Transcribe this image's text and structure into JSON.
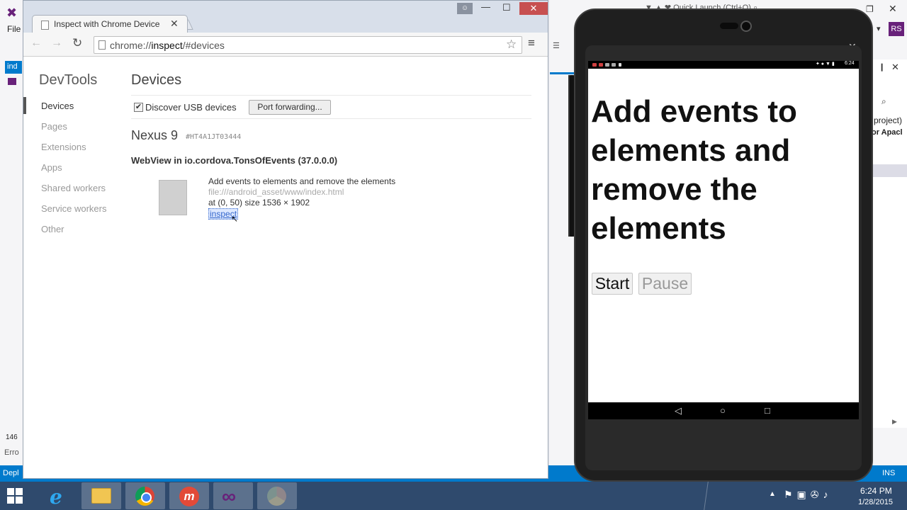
{
  "vs": {
    "file_menu": "File",
    "left_tab": "ind",
    "left_number": "146",
    "left_error": "Erro",
    "status_left": "Depl",
    "status_ins": "INS",
    "right_text_1": "project)",
    "right_text_2": "or Apacl",
    "user_initials": "RS",
    "top_fragment": "▼ ▲ ❤ Quick Launch (Ctrl+Q) ⌕"
  },
  "chrome": {
    "tab_title": "Inspect with Chrome Devices",
    "url_scheme": "chrome://",
    "url_host": "inspect",
    "url_path": "/#devices",
    "sidebar_title": "DevTools",
    "nav": [
      {
        "label": "Devices",
        "active": true
      },
      {
        "label": "Pages"
      },
      {
        "label": "Extensions"
      },
      {
        "label": "Apps"
      },
      {
        "label": "Shared workers"
      },
      {
        "label": "Service workers"
      },
      {
        "label": "Other"
      }
    ],
    "heading": "Devices",
    "discover_label": "Discover USB devices",
    "discover_checked": true,
    "port_forwarding_label": "Port forwarding...",
    "device_name": "Nexus 9",
    "device_serial": "#HT4A1JT03444",
    "webview_title": "WebView in io.cordova.TonsOfEvents (37.0.0.0)",
    "target_title": "Add events to elements and remove the elements",
    "target_url": "file:///android_asset/www/index.html",
    "target_meta": "at (0, 50)  size 1536 × 1902",
    "inspect_label": "inspect"
  },
  "emulator": {
    "status_time": "6:24",
    "status_icons": "✦ ● ▼ ▮",
    "app_heading": "Add events to elements and remove the elements",
    "start_label": "Start",
    "pause_label": "Pause",
    "nav_back": "◁",
    "nav_home": "○",
    "nav_recents": "□"
  },
  "taskbar": {
    "time": "6:24 PM",
    "date": "1/28/2015",
    "ie_glyph": "e",
    "m_glyph": "m",
    "tray_icons": "⚑▣✇♪"
  },
  "colors": {
    "vs_accent": "#007acc",
    "vs_purple": "#68217a",
    "taskbar": "#2f4a6d",
    "link": "#3366cc"
  }
}
